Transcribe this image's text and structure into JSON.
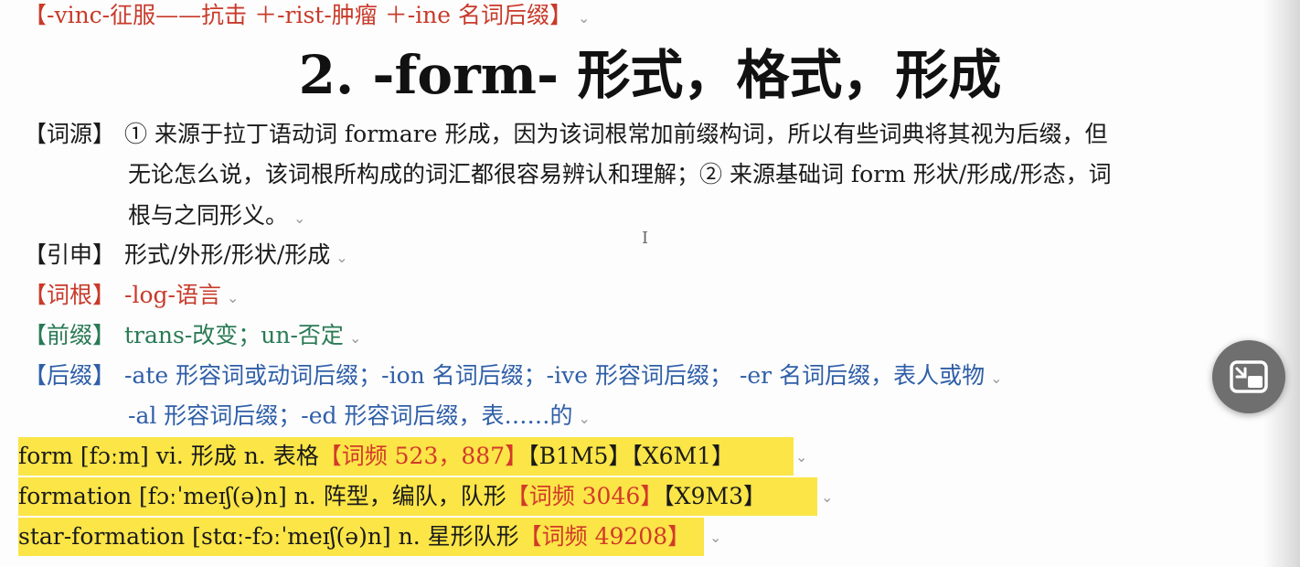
{
  "top_line": "【-vinc-征服——抗击 ＋-rist-肿瘤 ＋-ine 名词后缀】",
  "title": "2. -form- 形式，格式，形成",
  "etymology": {
    "label": "【词源】",
    "line1": "① 来源于拉丁语动词 formare 形成，因为该词根常加前缀构词，所以有些词典将其视为后缀，但",
    "line2": "无论怎么说，该词根所构成的词汇都很容易辨认和理解；② 来源基础词 form 形状/形成/形态，词",
    "line3": "根与之同形义。"
  },
  "extension": {
    "label": "【引申】",
    "text": "形式/外形/形状/形成"
  },
  "root": {
    "label": "【词根】",
    "text": "-log-语言"
  },
  "prefix": {
    "label": "【前缀】",
    "text": "trans-改变；un-否定"
  },
  "suffix": {
    "label": "【后缀】",
    "line1": "-ate 形容词或动词后缀；-ion 名词后缀；-ive 形容词后缀；  -er 名词后缀，表人或物",
    "line2": "-al 形容词后缀；-ed 形容词后缀，表……的"
  },
  "words": [
    {
      "entry": "form [fɔːm] vi. 形成 n. 表格",
      "freq": "【词频 523，887】",
      "tags": "【B1M5】【X6M1】"
    },
    {
      "entry": "formation [fɔːˈmeɪʃ(ə)n] n. 阵型，编队，队形",
      "freq": "【词频 3046】",
      "tags": "【X9M3】"
    },
    {
      "entry": "star-formation [stɑː-fɔːˈmeɪʃ(ə)n] n. 星形队形",
      "freq": "【词频 49208】",
      "tags": ""
    }
  ],
  "pip_icon": "picture-in-picture-exit-icon",
  "colors": {
    "red": "#c83a2a",
    "green": "#2a7a55",
    "blue": "#2f5fa8",
    "highlight": "#fbe547"
  }
}
